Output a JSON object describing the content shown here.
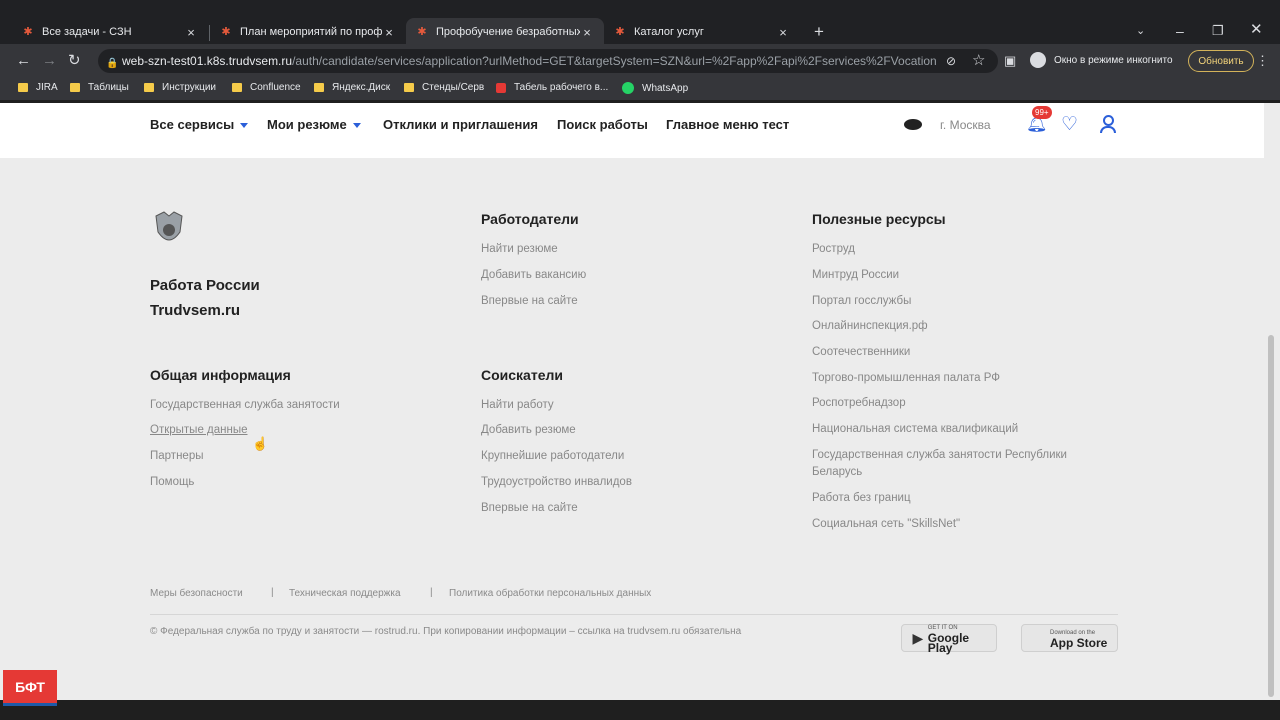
{
  "browser": {
    "tabs": [
      {
        "title": "Все задачи - СЗН"
      },
      {
        "title": "План мероприятий по профиле"
      },
      {
        "title": "Профобучение безработных"
      },
      {
        "title": "Каталог услуг"
      }
    ],
    "new_tab": "+",
    "url_host": "web-szn-test01.k8s.trudvsem.ru",
    "url_path": "/auth/candidate/services/application?urlMethod=GET&targetSystem=SZN&url=%2Fapp%2Fapi%2Fservices%2FVocationTraini...",
    "incognito_label": "Окно в режиме инкогнито",
    "update_label": "Обновить",
    "bookmarks": [
      "JIRA",
      "Таблицы",
      "Инструкции",
      "Confluence",
      "Яндекс.Диск",
      "Стенды/Серв",
      "Табель рабочего в...",
      "WhatsApp"
    ]
  },
  "header": {
    "nav": [
      "Все сервисы",
      "Мои резюме",
      "Отклики и приглашения",
      "Поиск работы",
      "Главное меню тест"
    ],
    "city": "г. Москва",
    "notif_badge": "99+"
  },
  "footer": {
    "brand_line1": "Работа России",
    "brand_line2": "Trudvsem.ru",
    "general": {
      "title": "Общая информация",
      "links": [
        "Государственная служба занятости",
        "Открытые данные",
        "Партнеры",
        "Помощь"
      ]
    },
    "employers": {
      "title": "Работодатели",
      "links": [
        "Найти резюме",
        "Добавить вакансию",
        "Впервые на сайте"
      ]
    },
    "seekers": {
      "title": "Соискатели",
      "links": [
        "Найти работу",
        "Добавить резюме",
        "Крупнейшие работодатели",
        "Трудоустройство инвалидов",
        "Впервые на сайте"
      ]
    },
    "resources": {
      "title": "Полезные ресурсы",
      "links": [
        "Роструд",
        "Минтруд России",
        "Портал госслужбы",
        "Онлайнинспекция.рф",
        "Соотечественники",
        "Торгово-промышленная палата РФ",
        "Роспотребнадзор",
        "Национальная система квалификаций",
        "Государственная служба занятости Республики",
        "Беларусь",
        "Работа без границ",
        "Социальная сеть \"SkillsNet\""
      ]
    },
    "bottom_links": [
      "Меры безопасности",
      "Техническая поддержка",
      "Политика обработки персональных данных"
    ],
    "divider": "|",
    "copyright": "© Федеральная служба по труду и занятости — rostrud.ru. При копировании информации – ссылка на trudvsem.ru обязательна",
    "google_small": "GET IT ON",
    "google_big": "Google Play",
    "apple_small": "Download on the",
    "apple_big": "App Store"
  },
  "overlay_logo": "БФТ"
}
